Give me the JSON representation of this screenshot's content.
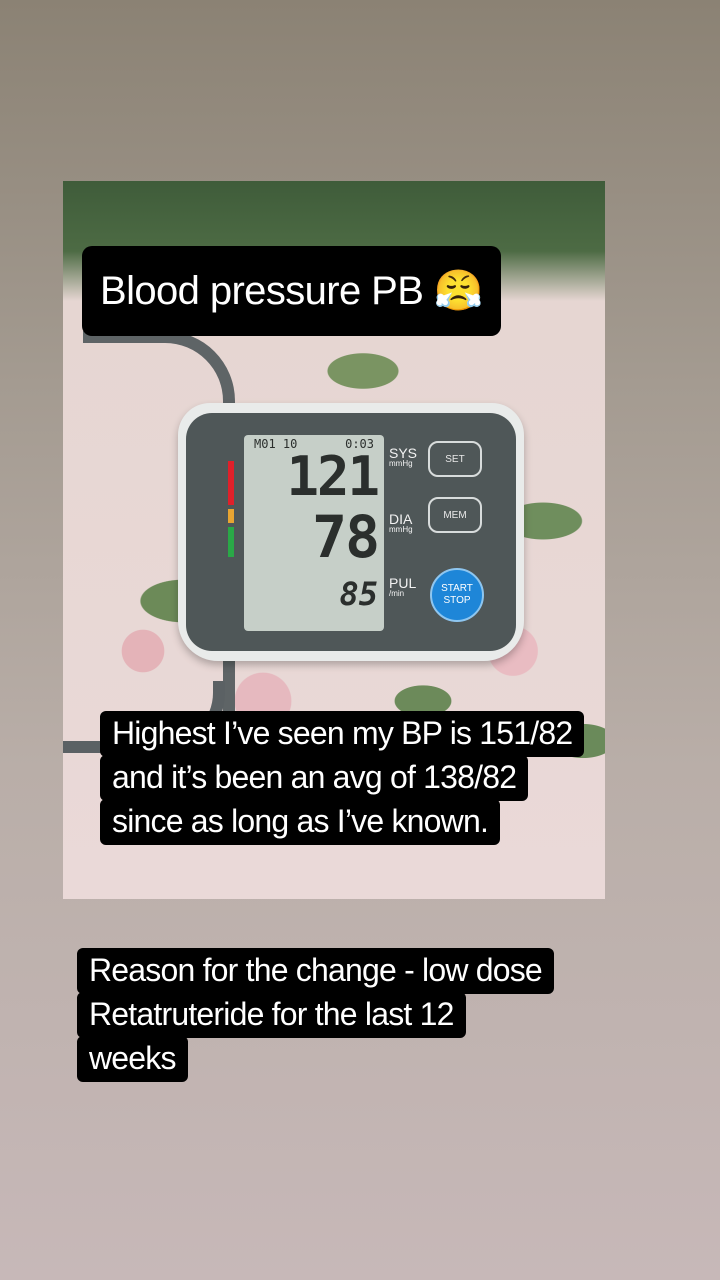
{
  "story": {
    "title_caption": "Blood pressure PB 😤",
    "caption_middle": [
      "Highest I’ve seen my BP is 151/82",
      "and it’s been an avg of 138/82",
      "since as long as I’ve known."
    ],
    "caption_bottom": [
      "Reason for the change - low dose",
      "Retatruteride for the last 12",
      "weeks"
    ]
  },
  "monitor": {
    "lcd_date": "M01 10",
    "lcd_time": "0:03",
    "systolic": "121",
    "diastolic": "78",
    "pulse": "85",
    "sys_label": "SYS",
    "sys_unit": "mmHg",
    "dia_label": "DIA",
    "dia_unit": "mmHg",
    "pul_label": "PUL",
    "pul_unit": "/min",
    "set_button": "SET",
    "mem_button": "MEM",
    "start_label": "START",
    "stop_label": "STOP",
    "colors": {
      "button_blue": "#1e86d8",
      "red": "#e0202a",
      "amber": "#e8a532",
      "green": "#2aa847"
    }
  }
}
